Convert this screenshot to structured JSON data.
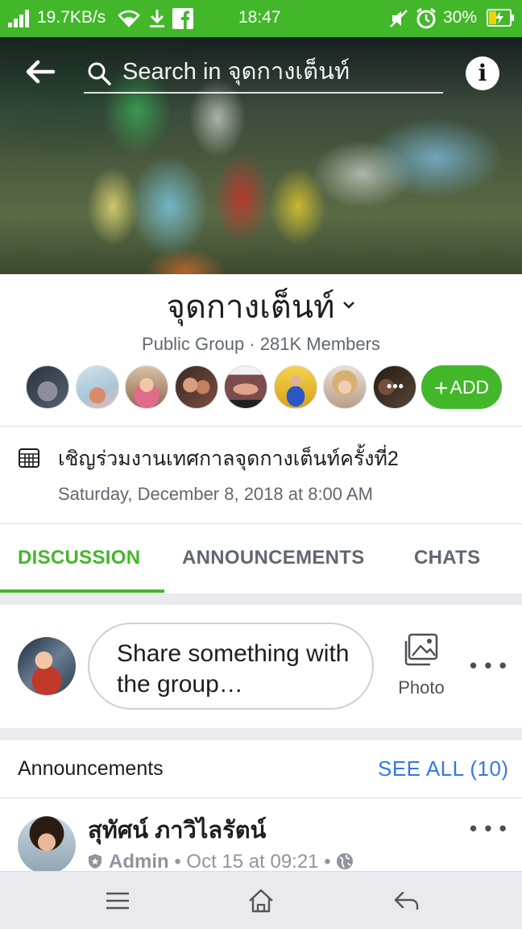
{
  "status_bar": {
    "network_speed": "19.7KB/s",
    "time": "18:47",
    "battery_percent": "30%",
    "icons": [
      "signal-icon",
      "wifi-icon",
      "download-icon",
      "facebook-icon",
      "mute-icon",
      "alarm-icon",
      "battery-charging-icon"
    ]
  },
  "header": {
    "search_placeholder": "Search in จุดกางเต็นท์",
    "icons": [
      "back-arrow-icon",
      "search-icon",
      "info-icon"
    ]
  },
  "group": {
    "name": "จุดกางเต็นท์",
    "privacy": "Public Group",
    "members_count": "281K Members",
    "meta_separator": "·",
    "add_label": "ADD",
    "member_avatars": [
      "member-1",
      "member-2",
      "member-3",
      "member-4",
      "member-5",
      "member-6",
      "member-7",
      "member-8-more"
    ],
    "more_glyph": "•••"
  },
  "event": {
    "title": "เชิญร่วมงานเทศกาลจุดกางเต็นท์ครั้งที่2",
    "datetime": "Saturday, December 8, 2018 at 8:00 AM"
  },
  "tabs": [
    {
      "label": "DISCUSSION",
      "active": true
    },
    {
      "label": "ANNOUNCEMENTS",
      "active": false
    },
    {
      "label": "CHATS",
      "active": false
    }
  ],
  "composer": {
    "prompt": "Share something with the group…",
    "photo_label": "Photo",
    "more_glyph": "• • •"
  },
  "announcements": {
    "title": "Announcements",
    "see_all": "SEE ALL (10)",
    "post": {
      "author": "สุทัศน์ ภาวิไลรัตน์",
      "role": "Admin",
      "separator": "•",
      "time": "Oct 15 at 09:21",
      "more_glyph": "• • •"
    }
  },
  "colors": {
    "accent_green": "#42b72a",
    "link_blue": "#3578e5",
    "secondary_text": "#606770"
  }
}
